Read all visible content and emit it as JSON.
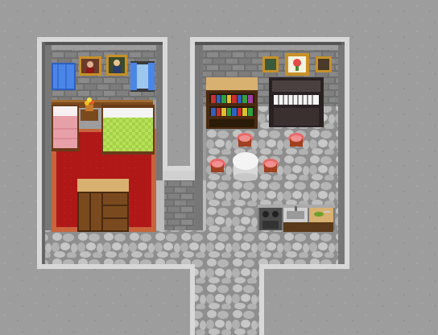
{
  "scene": {
    "description_visible_text": "",
    "palette": {
      "outer_stone": "#9c9c9c",
      "outer_stone_dark": "#8a8a8a",
      "wall_brick": "#6f6f6f",
      "wall_brick_light": "#8b8b8b",
      "wall_trim": "#d6d6d6",
      "wall_trim_shadow": "#5a5a5a",
      "floor_cobble": "#b9b9b9",
      "floor_cobble_dark": "#8c8c8c",
      "carpet_red": "#b51a1a",
      "carpet_border": "#c8643c",
      "bed_green": "#a8d44a",
      "bed_pink": "#e8a0a8",
      "wood": "#7a4a1e",
      "wood_dark": "#4a2a10",
      "curtain_blue": "#4a86e8",
      "piano_black": "#2a2222",
      "stool_pink": "#e86a6a",
      "table_white": "#f0f0f0",
      "stove": "#5c5c5c"
    },
    "icons": [
      "framed-portrait-icon",
      "framed-painting-icon",
      "flower-painting-icon",
      "window-curtain-icon",
      "bed-icon",
      "flower-pot-icon",
      "dresser-icon",
      "bookshelf-icon",
      "piano-icon",
      "stool-icon",
      "round-table-icon",
      "stove-icon",
      "sink-icon",
      "cutting-board-icon"
    ]
  }
}
